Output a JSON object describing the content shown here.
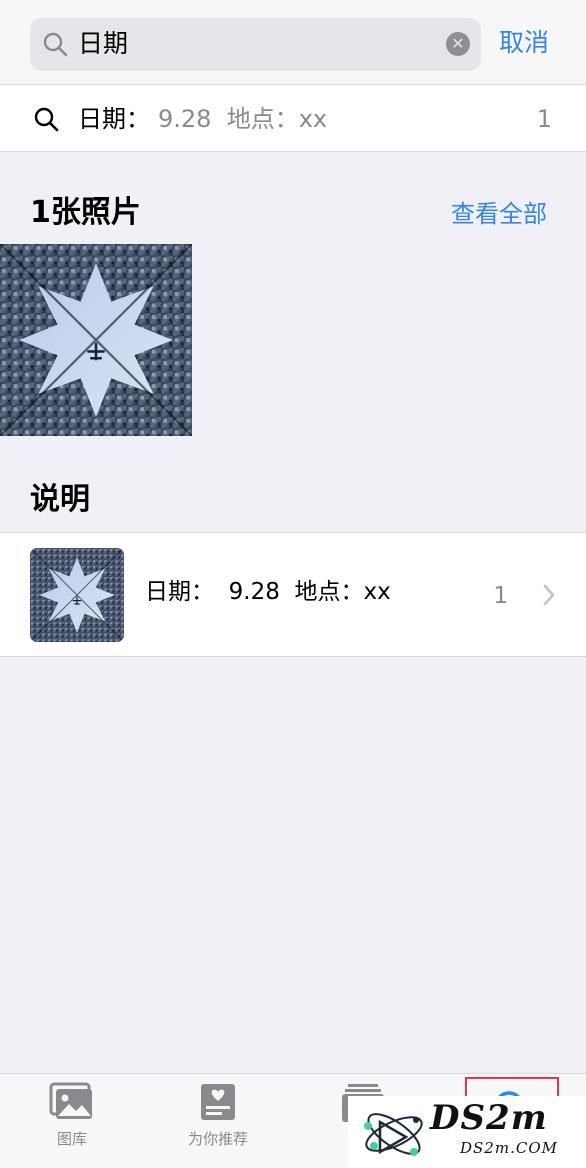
{
  "search": {
    "query": "日期",
    "cancel_label": "取消"
  },
  "suggestion": {
    "key_label": "日期：",
    "value_text": "9.28  地点：xx",
    "count": "1"
  },
  "photos_section": {
    "title": "1张照片",
    "see_all_label": "查看全部"
  },
  "captions_section": {
    "title": "说明",
    "item": {
      "text": "日期：  9.28  地点：xx",
      "count": "1"
    }
  },
  "tab_bar": {
    "tabs": [
      {
        "label": "图库",
        "icon": "photo-library-icon"
      },
      {
        "label": "为你推荐",
        "icon": "for-you-icon"
      },
      {
        "label": "",
        "icon": "albums-icon"
      },
      {
        "label": "",
        "icon": "search-icon"
      }
    ]
  },
  "watermark": {
    "main": "DS2m",
    "sub": "DS2m.COM"
  },
  "colors": {
    "accent": "#2f86f4",
    "background": "#f1f0f6",
    "secondary_text": "#8a8a8e",
    "highlight": "#e8383d"
  }
}
